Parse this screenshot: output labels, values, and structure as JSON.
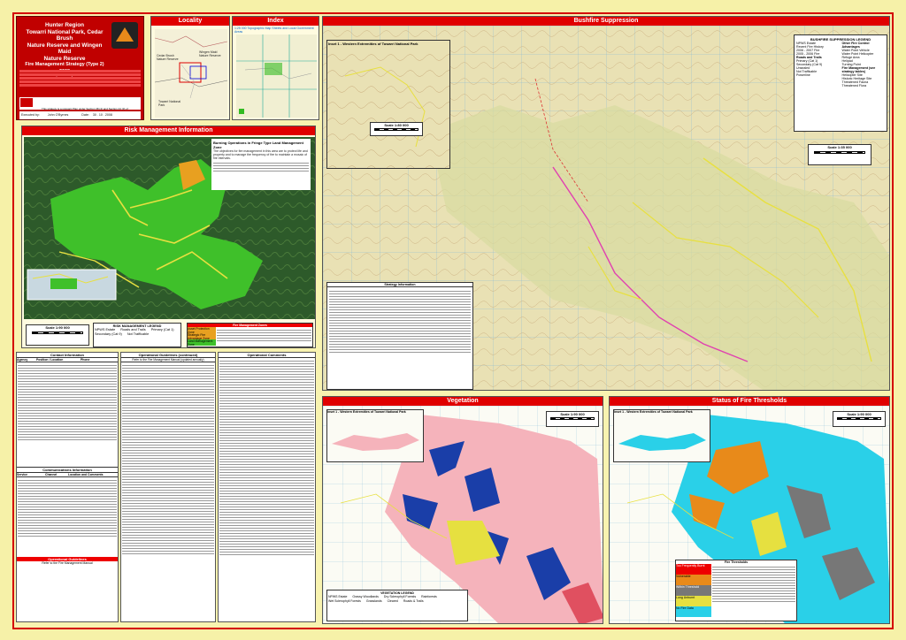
{
  "header": {
    "region": "Hunter Region",
    "title_lines": [
      "Towarri National Park, Cedar Brush",
      "Nature Reserve and Wingen Maid",
      "Nature Reserve"
    ],
    "subtitle": "Fire Management Strategy (Type 2)",
    "year": "2008",
    "sheet": "Sheet 1 of 1",
    "executed_by": "Executed by:",
    "executed_name": "John O'Byrnes",
    "date_label": "Date:",
    "date_value": "30 . 10 . 2008",
    "notice": "This strategy is a relevant Plan under Section 38 (4) and Section 44 (3) of Rural Fires Act 1997"
  },
  "panels": {
    "locality": "Locality",
    "index": "Index",
    "bushfire": "Bushfire Suppression",
    "risk": "Risk Management Information",
    "vegetation": "Vegetation",
    "thresholds": "Status of Fire Thresholds"
  },
  "locality_labels": [
    "Cedar Brush Nature Reserve",
    "Wingen Maid Nature Reserve",
    "Towarri National Park"
  ],
  "index_heading": "1:25 000 Topographic Map Sheets and Local Government Areas",
  "inset_title": "Inset 1 - Western Extremities of Towarri National Park",
  "bushfire_legend": {
    "title": "BUSHFIRE SUPPRESSION LEGEND",
    "items": [
      "NPWS Estate",
      "Recent Fire History",
      "2006 - 2007 Fire",
      "2005 - 2006 Fire",
      "Roads and Trails",
      "Primary (Cat 1)",
      "Secondary (Cat 9)",
      "Unsealed",
      "Not Trafficable",
      "Powerline",
      "Fire Management (see strategy tables)",
      "Helicopter Site",
      "Historic Heritage Site",
      "Threatened Fauna",
      "Threatened Flora",
      "Threatened Flora"
    ],
    "other_title": "Other Fire Control Advantages",
    "other_items": [
      "Water Point Vehicle",
      "Water Point Helicopter",
      "Refuge Area",
      "Helipad",
      "Turning Point"
    ]
  },
  "scales": {
    "inset": "Scale 1:80 000",
    "main": "Scale 1:35 000",
    "risk": "Scale 1:90 000",
    "veg": "Scale 1:90 000",
    "thresh": "Scale 1:90 000"
  },
  "risk_text": {
    "heading": "Burning Operations in Fringe Type Land Management Zone",
    "body": "The objectives for fire management in this area are to protect life and property and to manage the frequency of fire to maintain a mosaic of fire intervals.",
    "legend_title": "RISK MANAGEMENT LEGEND",
    "legend_items": [
      "NPWS Estate",
      "Roads and Trails",
      "Primary (Cat 1)",
      "Secondary (Cat 9)",
      "Not Trafficable"
    ],
    "zones_title": "Fire Management Zones",
    "zones": [
      "Asset Protection Zone",
      "Strategic Fire Advantage Zone",
      "Land Management Zone"
    ]
  },
  "strategy_heading": "Strategy Information",
  "contact_heading": "Contact Information",
  "contact_cols": [
    "Agency",
    "Position / Location",
    "Phone"
  ],
  "comm_heading": "Communications Information",
  "comm_cols": [
    "Service",
    "Channel",
    "Location and Comments"
  ],
  "ops_heading": "Operational Guidelines",
  "ops_sub": "Refer to the Fire Management Manual",
  "ops_cont_heading": "Operational Guidelines (continued)",
  "ops_cont_sub": "Refer to the Fire Management Manual (updated annually)",
  "ops_comments_heading": "Operational Comments",
  "veg_legend": {
    "title": "VEGETATION LEGEND",
    "items": [
      "NPWS Estate",
      "Grassy Woodlands",
      "Dry Sclerophyll Forests",
      "Rainforests",
      "Wet Sclerophyll Forests",
      "Grasslands",
      "Cleared",
      "Roads & Trails"
    ]
  },
  "threshold_legend": {
    "title": "Fire Thresholds",
    "items": [
      "Too Frequently Burnt",
      "Vulnerable",
      "Within Threshold",
      "Long Unburnt",
      "No Fire Data"
    ]
  },
  "colors": {
    "frame": "#d40000",
    "title_bar": "#e00000",
    "park_green": "#33bb22",
    "topo": "#eae3b5",
    "veg_pink": "#f5b3bb",
    "veg_blue": "#1a3ea8",
    "thresh_cyan": "#2ad0e8",
    "thresh_orange": "#e88a1a",
    "thresh_grey": "#777777"
  }
}
